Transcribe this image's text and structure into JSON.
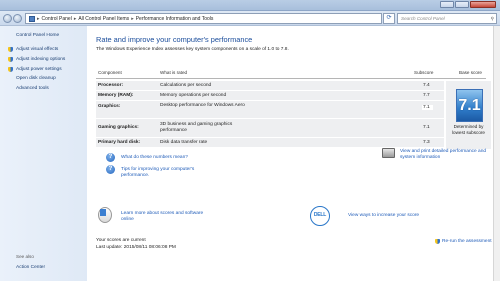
{
  "window": {
    "close_color": "#c6483a"
  },
  "address": {
    "breadcrumbs": [
      "Control Panel",
      "All Control Panel Items",
      "Performance Information and Tools"
    ],
    "separator": "▸",
    "refresh_icon": "refresh-icon",
    "search_placeholder": "Search Control Panel"
  },
  "sidebar": {
    "home": "Control Panel Home",
    "links": [
      "Adjust visual effects",
      "Adjust indexing options",
      "Adjust power settings",
      "Open disk cleanup",
      "Advanced tools"
    ],
    "see_also": "See also",
    "action_center": "Action Center"
  },
  "main": {
    "title": "Rate and improve your computer's performance",
    "intro": "The Windows Experience Index assesses key system components on a scale of 1.0 to 7.8.",
    "headers": {
      "component": "Component",
      "rated": "What is rated",
      "subscore": "Subscore",
      "base": "Base score"
    },
    "rows": [
      {
        "component": "Processor:",
        "rated": "Calculations per second",
        "subscore": "7.4"
      },
      {
        "component": "Memory (RAM):",
        "rated": "Memory operations per second",
        "subscore": "7.7"
      },
      {
        "component": "Graphics:",
        "rated": "Desktop performance for Windows Aero",
        "subscore": "7.1"
      },
      {
        "component": "Gaming graphics:",
        "rated": "3D business and gaming graphics performance",
        "subscore": "7.1"
      },
      {
        "component": "Primary hard disk:",
        "rated": "Disk data transfer rate",
        "subscore": "7.3"
      }
    ],
    "base_score": "7.1",
    "base_caption": "Determined by lowest subscore",
    "links": {
      "what": "What do these numbers mean?",
      "tips": "Tips for improving your computer's performance.",
      "print": "View and print detailed performance and system information",
      "learn": "Learn more about scores and software online",
      "ways": "View ways to increase your score",
      "rerun": "Re-run the assessment"
    },
    "dell_logo": "DELL",
    "status_current": "Your scores are current",
    "last_update": "Last update: 2015/08/11 08:06:08 PM"
  }
}
